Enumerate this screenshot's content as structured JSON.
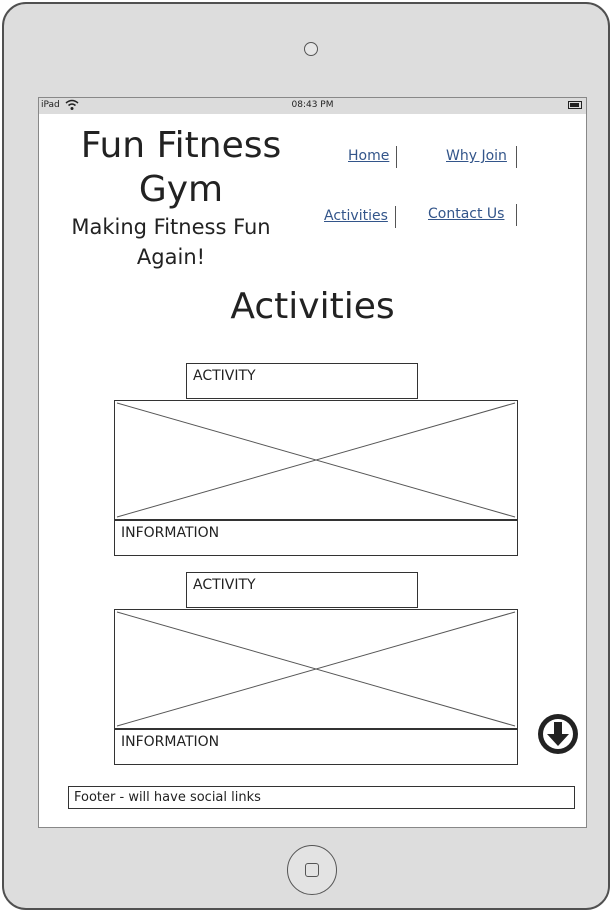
{
  "status_bar": {
    "carrier": "iPad",
    "time": "08:43 PM",
    "wifi_icon": "wifi-icon",
    "battery_icon": "battery-icon"
  },
  "header": {
    "title": "Fun Fitness Gym",
    "tagline": "Making Fitness Fun Again!"
  },
  "nav": {
    "items": [
      {
        "label": "Home"
      },
      {
        "label": "Why Join"
      },
      {
        "label": "Activities"
      },
      {
        "label": "Contact Us"
      }
    ],
    "link_color": "#33558a"
  },
  "main": {
    "heading": "Activities",
    "cards": [
      {
        "label": "ACTIVITY",
        "info": "INFORMATION"
      },
      {
        "label": "ACTIVITY",
        "info": "INFORMATION"
      }
    ],
    "scroll_icon": "arrow-down-circle-icon"
  },
  "footer": {
    "text": "Footer - will have social links"
  },
  "device": {
    "frame_color": "#dddddd",
    "home_button_icon": "home-button-icon",
    "camera_icon": "camera-icon"
  }
}
